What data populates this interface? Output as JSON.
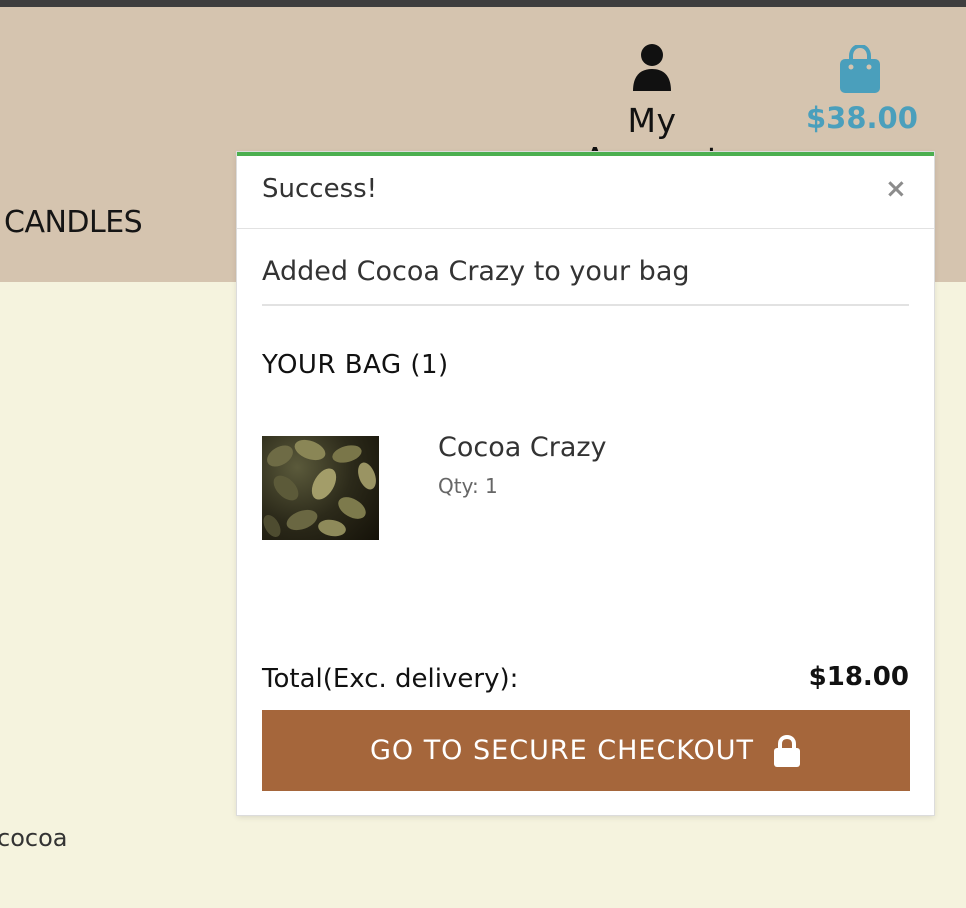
{
  "header": {
    "account_label": "My Account",
    "bag_total": "$38.00",
    "nav_candles": "CANDLES"
  },
  "content": {
    "product_snippet": "cocoa"
  },
  "toast": {
    "title": "Success!",
    "close_glyph": "×",
    "message": "Added Cocoa Crazy to your bag",
    "bag_heading": "YOUR BAG (1)",
    "item": {
      "name": "Cocoa Crazy",
      "qty": "Qty: 1"
    },
    "total_label": "Total(Exc. delivery):",
    "total_value": "$18.00",
    "checkout_label": "GO TO SECURE CHECKOUT"
  },
  "colors": {
    "header_bg": "#d5c4af",
    "page_bg": "#f5f3de",
    "accent_blue": "#4a9fbc",
    "success_green": "#4caf50",
    "checkout_brown": "#a5663b"
  },
  "icons": {
    "account": "user-icon",
    "bag": "shopping-bag-icon",
    "close": "close-icon",
    "checkout": "lock-icon"
  }
}
